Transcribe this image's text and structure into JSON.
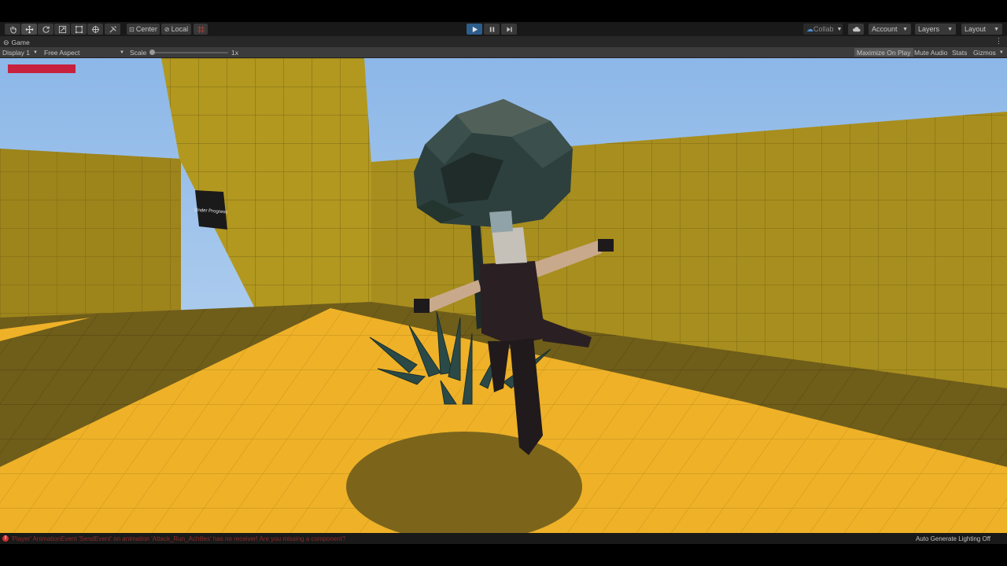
{
  "toolbar": {
    "tools": [
      "hand-tool",
      "move-tool",
      "rotate-tool",
      "scale-tool",
      "rect-tool",
      "transform-tool",
      "custom-tool"
    ],
    "pivot_label": "Center",
    "space_label": "Local",
    "collab_label": "Collab",
    "account_label": "Account",
    "layers_label": "Layers",
    "layout_label": "Layout",
    "play_state": "playing"
  },
  "game_tab": {
    "title": "Game",
    "display_label": "Display 1",
    "aspect_label": "Free Aspect",
    "scale_label": "Scale",
    "scale_value": "1x",
    "maximize_label": "Maximize On Play",
    "mute_label": "Mute Audio",
    "stats_label": "Stats",
    "gizmos_label": "Gizmos"
  },
  "scene": {
    "sign_text": "Under Progress",
    "health_fraction": 1.0,
    "health_color": "#c8213e"
  },
  "status": {
    "error_message": "'Player' AnimationEvent 'SendEvent' on animation 'Attack_Run_Achilles' has no receiver! Are you missing a component?",
    "lighting_label": "Auto Generate Lighting Off"
  },
  "colors": {
    "accent": "#2d5d8b",
    "wall": "#a88e1e",
    "floor_lit": "#eeb128",
    "floor_shadow": "#6f5d1a",
    "sky": "#8cb7e8",
    "error": "#d32f2f"
  }
}
